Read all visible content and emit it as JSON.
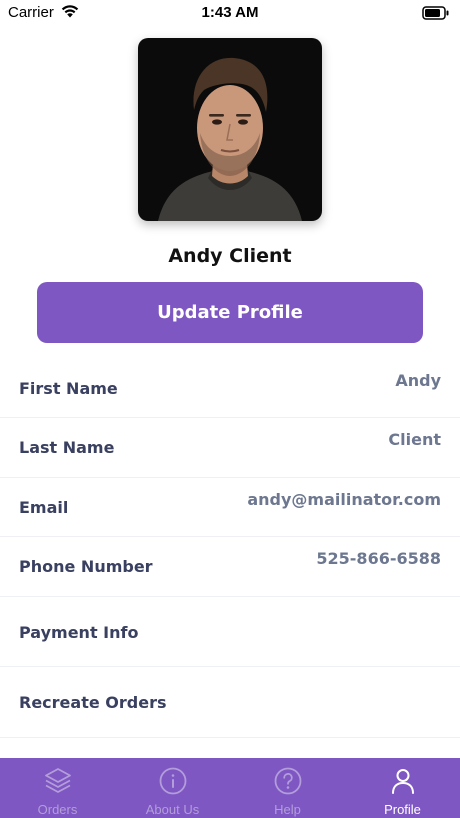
{
  "status_bar": {
    "carrier": "Carrier",
    "time": "1:43 AM"
  },
  "profile": {
    "name": "Andy Client",
    "update_button_label": "Update Profile"
  },
  "details": {
    "first_name": {
      "label": "First Name",
      "value": "Andy"
    },
    "last_name": {
      "label": "Last Name",
      "value": "Client"
    },
    "email": {
      "label": "Email",
      "value": "andy@mailinator.com"
    },
    "phone": {
      "label": "Phone Number",
      "value": "525-866-6588"
    },
    "payment": {
      "label": "Payment Info"
    },
    "recreate": {
      "label": "Recreate Orders"
    }
  },
  "tabs": [
    {
      "label": "Orders",
      "icon": "layers-icon",
      "active": false
    },
    {
      "label": "About Us",
      "icon": "info-icon",
      "active": false
    },
    {
      "label": "Help",
      "icon": "help-icon",
      "active": false
    },
    {
      "label": "Profile",
      "icon": "user-icon",
      "active": true
    }
  ],
  "colors": {
    "accent": "#7e57c2",
    "label": "#3a4060",
    "value": "#6d7890",
    "tab_inactive": "#b39ddb"
  }
}
